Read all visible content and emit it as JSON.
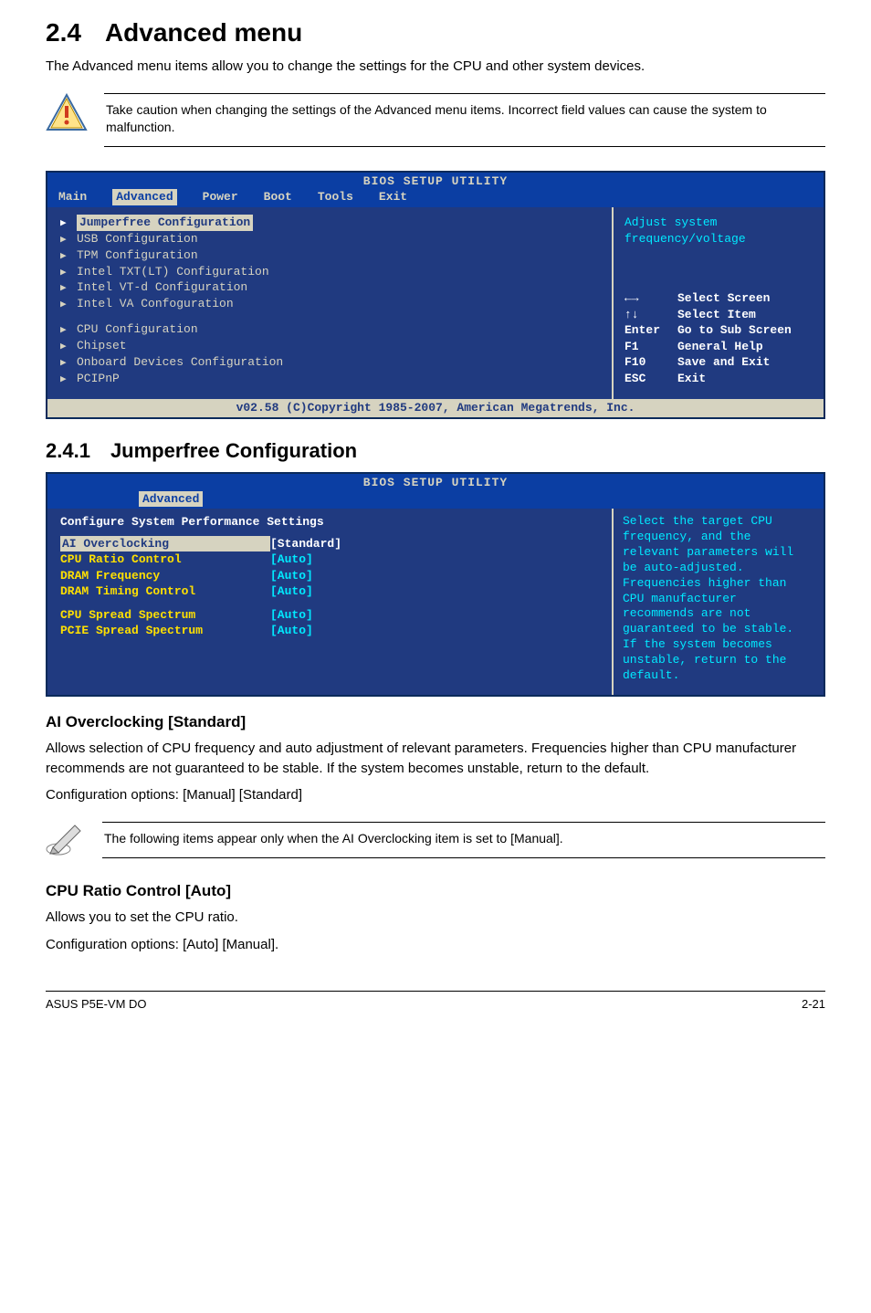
{
  "page": {
    "section_number": "2.4",
    "section_title": "Advanced menu",
    "intro": "The Advanced menu items allow you to change the settings for the CPU and other system devices.",
    "caution": "Take caution when changing the settings of the Advanced menu items. Incorrect field values can cause the system to malfunction.",
    "subsection_number": "2.4.1",
    "subsection_title": "Jumperfree Configuration",
    "ai_title": "AI Overclocking [Standard]",
    "ai_body": "Allows selection of CPU frequency and auto adjustment of relevant parameters. Frequencies higher than CPU manufacturer recommends are not guaranteed to be stable. If the system becomes unstable, return to the default.",
    "ai_config": "Configuration options: [Manual] [Standard]",
    "pencil_note": "The following items appear only when the AI Overclocking item is set to [Manual].",
    "cpu_ratio_title": "CPU Ratio Control [Auto]",
    "cpu_ratio_body": "Allows you to set the CPU ratio.",
    "cpu_ratio_config": "Configuration options: [Auto] [Manual].",
    "footer_left": "ASUS P5E-VM DO",
    "footer_right": "2-21"
  },
  "bios1": {
    "title": "BIOS SETUP UTILITY",
    "tabs": [
      "Main",
      "Advanced",
      "Power",
      "Boot",
      "Tools",
      "Exit"
    ],
    "selected_tab_index": 1,
    "left_items_group1": [
      "Jumperfree Configuration",
      "USB Configuration",
      "TPM Configuration",
      "Intel TXT(LT) Configuration",
      "Intel VT-d Configuration",
      "Intel VA Confoguration"
    ],
    "left_items_group2": [
      "CPU Configuration",
      "Chipset",
      "Onboard Devices Configuration",
      "PCIPnP"
    ],
    "selected_left_item": "Jumperfree Configuration",
    "right_top": "Adjust system\nfrequency/voltage",
    "right_keys": [
      {
        "key": "←→",
        "val": "Select Screen"
      },
      {
        "key": "↑↓",
        "val": "Select Item"
      },
      {
        "key": "Enter",
        "val": "Go to Sub Screen"
      },
      {
        "key": "F1",
        "val": "General Help"
      },
      {
        "key": "F10",
        "val": "Save and Exit"
      },
      {
        "key": "ESC",
        "val": "Exit"
      }
    ],
    "copyright": "v02.58 (C)Copyright 1985-2007, American Megatrends, Inc."
  },
  "bios2": {
    "title": "BIOS SETUP UTILITY",
    "tab": "Advanced",
    "heading": "Configure System Performance Settings",
    "settings": [
      {
        "label": "AI Overclocking",
        "value": "[Standard]",
        "selected": true
      },
      {
        "label": "CPU Ratio Control",
        "value": "[Auto]"
      },
      {
        "label": "DRAM Frequency",
        "value": "[Auto]"
      },
      {
        "label": "DRAM Timing Control",
        "value": "[Auto]"
      }
    ],
    "settings2": [
      {
        "label": "CPU Spread Spectrum",
        "value": "[Auto]"
      },
      {
        "label": "PCIE Spread Spectrum",
        "value": "[Auto]"
      }
    ],
    "right_text": "Select the target CPU frequency, and the relevant parameters will be auto-adjusted. Frequencies higher than CPU manufacturer recommends are not guaranteed to be stable. If the system becomes unstable, return to the default."
  }
}
